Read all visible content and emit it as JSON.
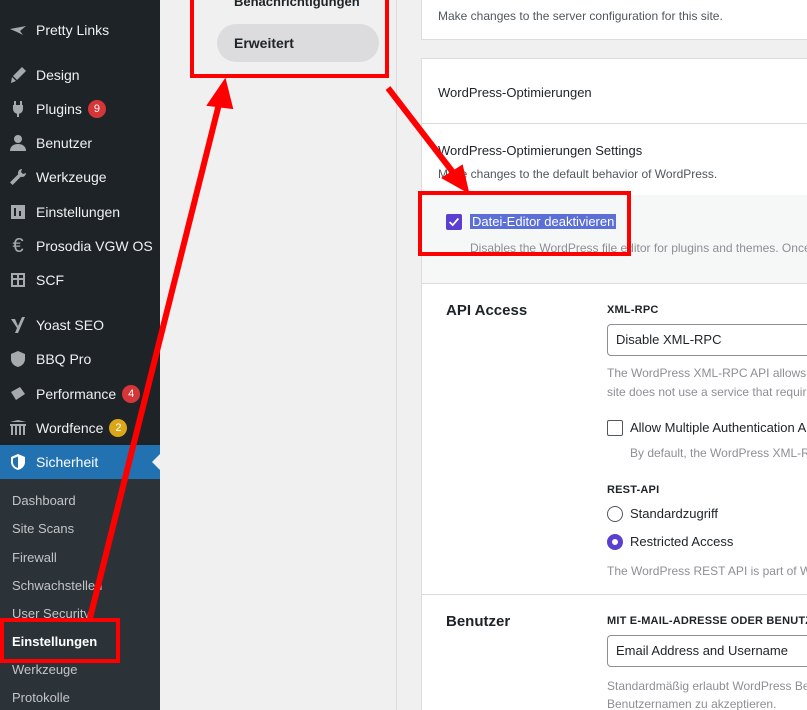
{
  "sidebar": {
    "items": [
      {
        "label": "Pretty Links",
        "icon": "pretty-links-icon"
      },
      {
        "label": "Design",
        "icon": "paintbrush-icon"
      },
      {
        "label": "Plugins",
        "icon": "plug-icon",
        "badge": "9"
      },
      {
        "label": "Benutzer",
        "icon": "user-icon"
      },
      {
        "label": "Werkzeuge",
        "icon": "wrench-icon"
      },
      {
        "label": "Einstellungen",
        "icon": "sliders-icon"
      },
      {
        "label": "Prosodia VGW OS",
        "icon": "euro-icon"
      },
      {
        "label": "SCF",
        "icon": "grid-icon"
      },
      {
        "label": "Yoast SEO",
        "icon": "yoast-icon"
      },
      {
        "label": "BBQ Pro",
        "icon": "shield-icon"
      },
      {
        "label": "Performance",
        "icon": "performance-icon",
        "badge": "4"
      },
      {
        "label": "Wordfence",
        "icon": "wordfence-icon",
        "badge": "2"
      },
      {
        "label": "Sicherheit",
        "icon": "security-shield-icon"
      }
    ],
    "submenu": [
      "Dashboard",
      "Site Scans",
      "Firewall",
      "Schwachstellen",
      "User Security",
      "Einstellungen",
      "Werkzeuge",
      "Protokolle"
    ]
  },
  "subnav": {
    "prev_item": "Benachrichtigungen",
    "active_item": "Erweitert"
  },
  "main": {
    "server_config_desc": "Make changes to the server configuration for this site.",
    "wp_opt_title": "WordPress-Optimierungen",
    "wp_opt_settings_title": "WordPress-Optimierungen Settings",
    "wp_opt_desc": "Make changes to the default behavior of WordPress.",
    "file_editor_label": "Datei-Editor deaktivieren",
    "file_editor_desc": "Disables the WordPress file editor for plugins and themes. Once",
    "api_access_title": "API Access",
    "xmlrpc_label": "XML-RPC",
    "xmlrpc_value": "Disable XML-RPC",
    "xmlrpc_desc_1": "The WordPress XML-RPC API allows ex",
    "xmlrpc_desc_2": "site does not use a service that require",
    "multi_auth_label": "Allow Multiple Authentication A",
    "multi_auth_desc": "By default, the WordPress XML-RP",
    "rest_api_label": "REST-API",
    "rest_option_1": "Standardzugriff",
    "rest_option_2": "Restricted Access",
    "rest_desc": "The WordPress REST API is part of Wo",
    "users_title": "Benutzer",
    "login_label": "MIT E-MAIL-ADRESSE ODER BENUTZERN",
    "login_value": "Email Address and Username",
    "login_desc_1": "Standardmäßig erlaubt WordPress Ber",
    "login_desc_2": "Benutzernamen zu akzeptieren."
  },
  "colors": {
    "sidebar_bg": "#1d2327",
    "active_blue": "#2271b1",
    "accent_purple": "#5b3fd1",
    "annotation_red": "#ff0000"
  }
}
